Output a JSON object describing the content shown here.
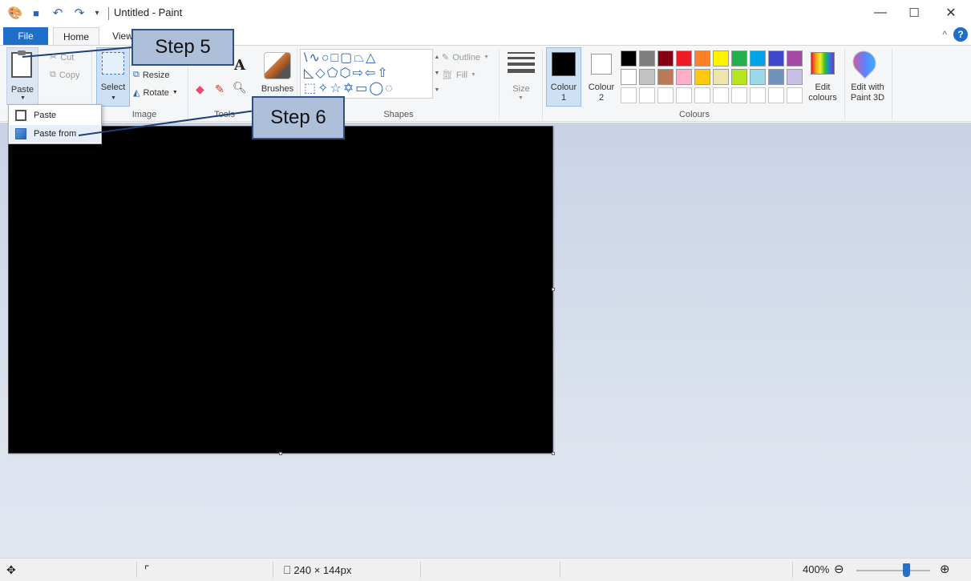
{
  "window": {
    "title": "Untitled - Paint",
    "minimize_icon": "—",
    "maximize_icon": "☐",
    "close_icon": "✕"
  },
  "tabs": {
    "file": "File",
    "home": "Home",
    "view": "View",
    "collapse_icon": "^",
    "help_icon": "?"
  },
  "clipboard": {
    "paste": "Paste",
    "cut": "Cut",
    "copy": "Copy"
  },
  "image": {
    "select": "Select",
    "resize": "Resize",
    "rotate": "Rotate",
    "group_label": "Image"
  },
  "tools": {
    "brushes": "Brushes",
    "group_label": "Tools",
    "text_tool": "A"
  },
  "shapes": {
    "row1": "\\∿○□▢⏢△",
    "row2": "◺◇⬠⬡⇨⇦⇧",
    "row3": "⬚✧☆✡▭◯◌",
    "outline": "Outline",
    "fill": "Fill",
    "group_label": "Shapes"
  },
  "size": {
    "label": "Size"
  },
  "colours": {
    "colour1_label": "Colour",
    "colour1_num": "1",
    "colour2_label": "Colour",
    "colour2_num": "2",
    "edit_colours_line1": "Edit",
    "edit_colours_line2": "colours",
    "edit_paint3d_line1": "Edit with",
    "edit_paint3d_line2": "Paint 3D",
    "group_label": "Colours",
    "palette_row1": [
      "#000000",
      "#7f7f7f",
      "#880015",
      "#ed1c24",
      "#ff7f27",
      "#fff200",
      "#22b14c",
      "#00a2e8",
      "#3f48cc",
      "#a349a4"
    ],
    "palette_row2": [
      "#ffffff",
      "#c3c3c3",
      "#b97a57",
      "#ffaec9",
      "#ffc90e",
      "#efe4b0",
      "#b5e61d",
      "#99d9ea",
      "#7092be",
      "#c8bfe7"
    ]
  },
  "paste_menu": {
    "paste": "Paste",
    "paste_from": "Paste from"
  },
  "statusbar": {
    "image_size": "240 × 144px",
    "zoom": "400%"
  },
  "callouts": {
    "step5": "Step 5",
    "step6": "Step 6"
  }
}
